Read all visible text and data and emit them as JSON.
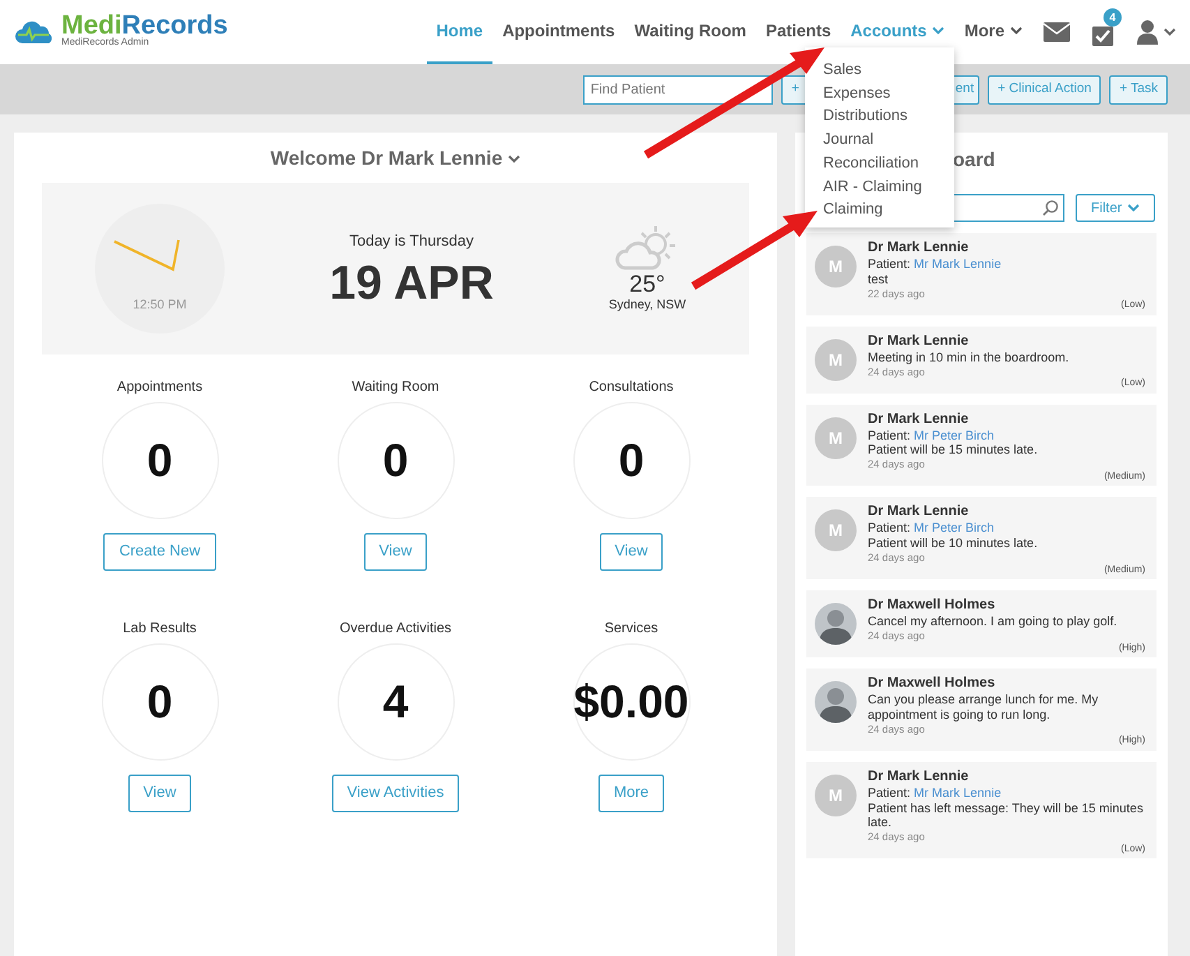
{
  "brand": {
    "name": "MediRecords",
    "subtitle": "MediRecords Admin"
  },
  "nav": [
    {
      "label": "Home",
      "selected": true,
      "expanded": false,
      "caret": false
    },
    {
      "label": "Appointments",
      "selected": false,
      "expanded": false,
      "caret": false
    },
    {
      "label": "Waiting Room",
      "selected": false,
      "expanded": false,
      "caret": false
    },
    {
      "label": "Patients",
      "selected": false,
      "expanded": false,
      "caret": false
    },
    {
      "label": "Accounts",
      "selected": false,
      "expanded": true,
      "caret": true
    },
    {
      "label": "More",
      "selected": false,
      "expanded": false,
      "caret": true
    }
  ],
  "tasks_badge": "4",
  "accounts_menu": [
    "Sales",
    "Expenses",
    "Distributions",
    "Journal",
    "Reconciliation",
    "AIR - Claiming",
    "Claiming"
  ],
  "toolbar": {
    "search": {
      "placeholder": "Find Patient"
    },
    "covered_button": {
      "start": "+",
      "end": "ent"
    },
    "buttons": [
      "+ Clinical Action",
      "+ Task"
    ]
  },
  "welcome": "Welcome Dr Mark Lennie",
  "today": {
    "time": "12:50 PM",
    "day": "Today is Thursday",
    "date": "19 APR",
    "temperature": "25°",
    "location": "Sydney, NSW"
  },
  "tiles": [
    {
      "label": "Appointments",
      "value": "0",
      "button": "Create New"
    },
    {
      "label": "Waiting Room",
      "value": "0",
      "button": "View"
    },
    {
      "label": "Consultations",
      "value": "0",
      "button": "View"
    },
    {
      "label": "Lab Results",
      "value": "0",
      "button": "View"
    },
    {
      "label": "Overdue Activities",
      "value": "4",
      "button": "View Activities"
    },
    {
      "label": "Services",
      "value": "$0.00",
      "button": "More"
    }
  ],
  "board": {
    "title_visible": "oard",
    "filter": "Filter",
    "messages": [
      {
        "sender": "Dr Mark Lennie",
        "avatar": {
          "kind": "initial",
          "letter": "M"
        },
        "patient_prefix": "Patient:",
        "patient": "Mr Mark Lennie",
        "text": "test",
        "time": "22 days ago",
        "priority": "(Low)"
      },
      {
        "sender": "Dr Mark Lennie",
        "avatar": {
          "kind": "initial",
          "letter": "M"
        },
        "text": "Meeting in 10 min in the boardroom.",
        "time": "24 days ago",
        "priority": "(Low)"
      },
      {
        "sender": "Dr Mark Lennie",
        "avatar": {
          "kind": "initial",
          "letter": "M"
        },
        "patient_prefix": "Patient:",
        "patient": "Mr Peter Birch",
        "text": "Patient will be 15 minutes late.",
        "time": "24 days ago",
        "priority": "(Medium)"
      },
      {
        "sender": "Dr Mark Lennie",
        "avatar": {
          "kind": "initial",
          "letter": "M"
        },
        "patient_prefix": "Patient:",
        "patient": "Mr Peter Birch",
        "text": "Patient will be 10 minutes late.",
        "time": "24 days ago",
        "priority": "(Medium)"
      },
      {
        "sender": "Dr Maxwell Holmes",
        "avatar": {
          "kind": "photo"
        },
        "text": "Cancel my afternoon. I am going to play golf.",
        "time": "24 days ago",
        "priority": "(High)"
      },
      {
        "sender": "Dr Maxwell Holmes",
        "avatar": {
          "kind": "photo"
        },
        "text": "Can you please arrange lunch for me. My appointment is going to run long.",
        "time": "24 days ago",
        "priority": "(High)"
      },
      {
        "sender": "Dr Mark Lennie",
        "avatar": {
          "kind": "initial",
          "letter": "M"
        },
        "patient_prefix": "Patient:",
        "patient": "Mr Mark Lennie",
        "text": "Patient has left message: They will be 15 minutes late.",
        "time": "24 days ago",
        "priority": "(Low)"
      }
    ]
  }
}
